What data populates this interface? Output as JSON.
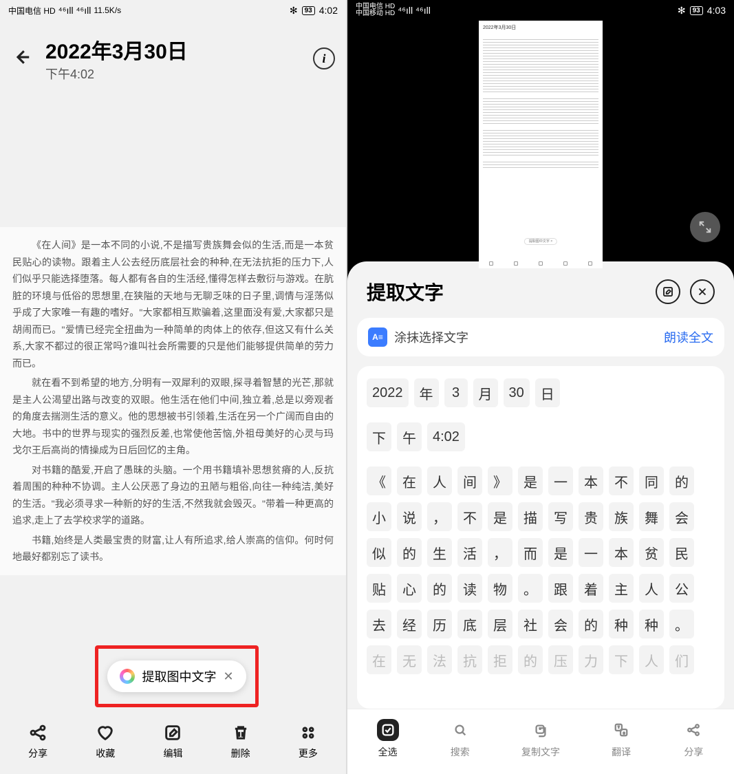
{
  "left": {
    "status": {
      "carrier1": "中国电信 HD",
      "signal": "⁴⁶ıll ⁴⁶ıll",
      "speed": "11.5K/s",
      "bt": "✻",
      "battery": "93",
      "time": "4:02"
    },
    "title_date": "2022年3月30日",
    "title_time": "下午4:02",
    "paragraphs": [
      "《在人间》是一本不同的小说,不是描写贵族舞会似的生活,而是一本贫民贴心的读物。跟着主人公去经历底层社会的种种,在无法抗拒的压力下,人们似乎只能选择堕落。每人都有各自的生活经,懂得怎样去敷衍与游戏。在肮脏的环境与低俗的思想里,在狭隘的天地与无聊乏味的日子里,调情与淫荡似乎成了大家唯一有趣的嗜好。\"大家都相互欺骗着,这里面没有爱,大家都只是胡闹而已。\"爱情已经完全扭曲为一种简单的肉体上的依存,但这又有什么关系,大家不都过的很正常吗?谁叫社会所需要的只是他们能够提供简单的劳力而已。",
      "就在看不到希望的地方,分明有一双犀利的双眼,探寻着智慧的光芒,那就是主人公渴望出路与改变的双眼。他生活在他们中间,独立着,总是以旁观者的角度去揣测生活的意义。他的思想被书引领着,生活在另一个广阔而自由的大地。书中的世界与现实的强烈反差,也常使他苦恼,外祖母美好的心灵与玛戈尔王后高尚的情操成为日后回忆的主角。",
      "对书籍的酷爱,开启了愚昧的头脑。一个用书籍填补思想贫瘠的人,反抗着周围的种种不协调。主人公厌恶了身边的丑陋与粗俗,向往一种纯洁,美好的生活。\"我必须寻求一种新的好的生活,不然我就会毁灭。\"带着一种更高的追求,走上了去学校求学的道路。",
      "书籍,始终是人类最宝贵的财富,让人有所追求,给人崇高的信仰。何时何地最好都别忘了读书。"
    ],
    "extract_label": "提取图中文字",
    "bottom": {
      "share": "分享",
      "fav": "收藏",
      "edit": "编辑",
      "del": "删除",
      "more": "更多"
    }
  },
  "right": {
    "status": {
      "carrier1": "中国电信 HD",
      "carrier2": "中国移动 HD",
      "signal": "⁴⁶ıll ⁴⁶ıll",
      "bt": "✻",
      "battery": "93",
      "time": "4:03"
    },
    "mini": {
      "date": "2022年3月30日",
      "chip": "提取图中文字 ×"
    },
    "sheet_title": "提取文字",
    "smear_label": "涂抹选择文字",
    "read_all": "朗读全文",
    "tokens_line1": [
      "2022",
      "年",
      "3",
      "月",
      "30",
      "日"
    ],
    "tokens_line2": [
      "下",
      "午",
      "4:02"
    ],
    "tokens_body": [
      "《",
      "在",
      "人",
      "间",
      "》",
      "是",
      "一",
      "本",
      "不",
      "同",
      "的",
      "小",
      "说",
      "，",
      "不",
      "是",
      "描",
      "写",
      "贵",
      "族",
      "舞",
      "会",
      "似",
      "的",
      "生",
      "活",
      "，",
      "而",
      "是",
      "一",
      "本",
      "贫",
      "民",
      "贴",
      "心",
      "的",
      "读",
      "物",
      "。",
      "跟",
      "着",
      "主",
      "人",
      "公",
      "去",
      "经",
      "历",
      "底",
      "层",
      "社",
      "会",
      "的",
      "种",
      "种",
      "。"
    ],
    "tokens_faded": [
      "在",
      "无",
      "法",
      "抗",
      "拒",
      "的",
      "压",
      "力",
      "下",
      "人",
      "们"
    ],
    "sheet_bb": {
      "select_all": "全选",
      "search": "搜索",
      "copy": "复制文字",
      "translate": "翻译",
      "share": "分享"
    }
  }
}
